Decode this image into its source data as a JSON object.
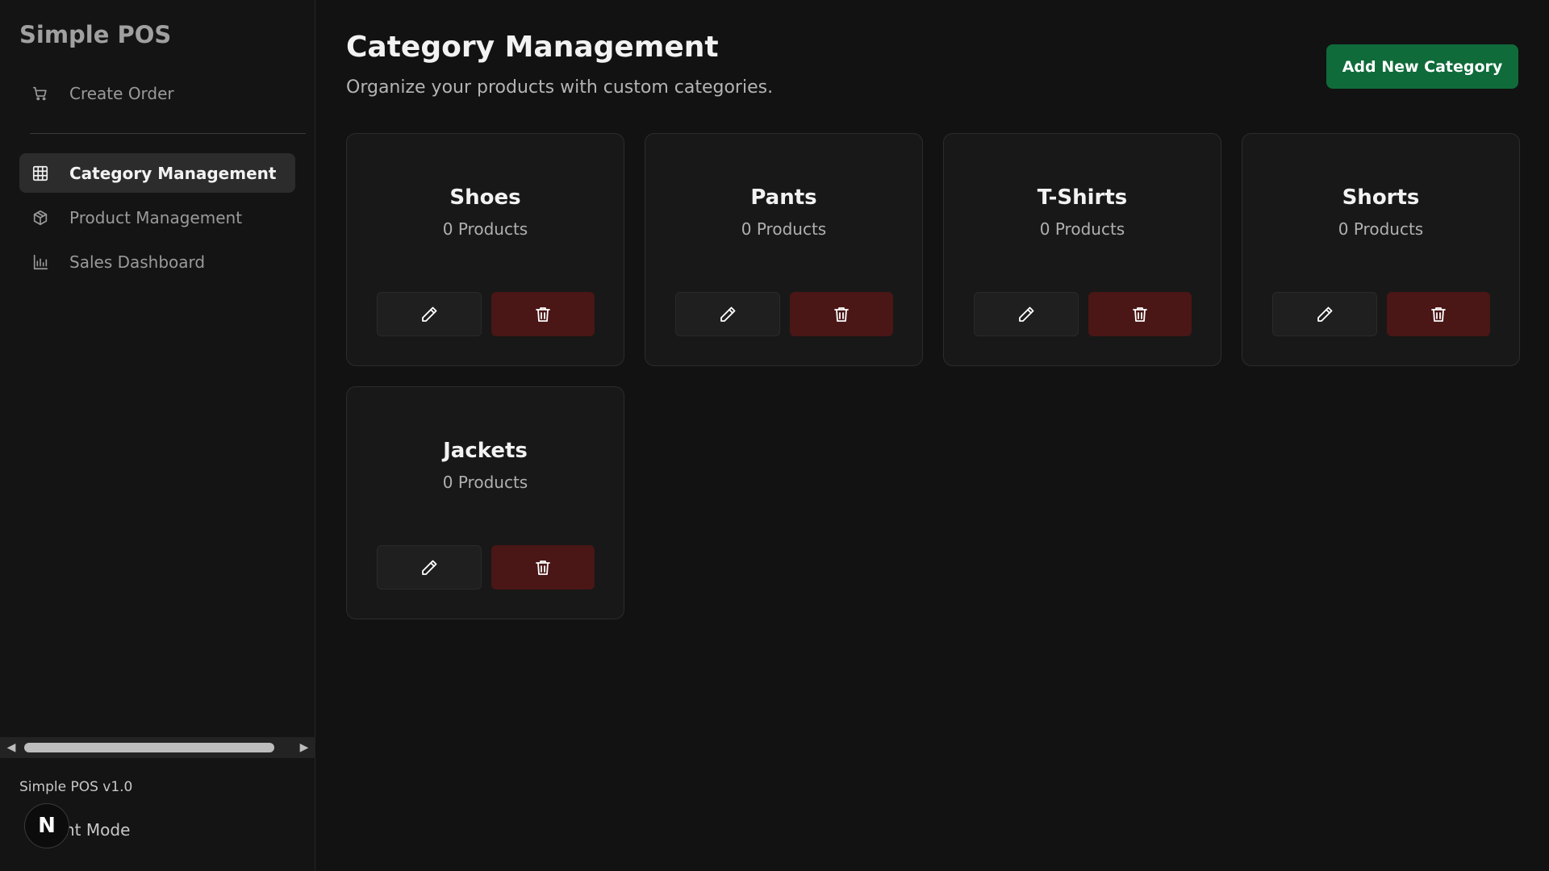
{
  "app": {
    "brand": "Simple POS",
    "version": "Simple POS v1.0",
    "mode_label": "nt Mode",
    "badge_letter": "N"
  },
  "sidebar": {
    "items": [
      {
        "label": "Create Order",
        "icon": "cart-icon",
        "active": false
      },
      {
        "label": "Category Management",
        "icon": "grid-icon",
        "active": true
      },
      {
        "label": "Product Management",
        "icon": "box-icon",
        "active": false
      },
      {
        "label": "Sales Dashboard",
        "icon": "bar-chart-icon",
        "active": false
      }
    ]
  },
  "header": {
    "title": "Category Management",
    "subtitle": "Organize your products with custom categories.",
    "add_button_label": "Add New Category"
  },
  "categories": [
    {
      "name": "Shoes",
      "count": "0 Products"
    },
    {
      "name": "Pants",
      "count": "0 Products"
    },
    {
      "name": "T-Shirts",
      "count": "0 Products"
    },
    {
      "name": "Shorts",
      "count": "0 Products"
    },
    {
      "name": "Jackets",
      "count": "0 Products"
    }
  ],
  "colors": {
    "background": "#121212",
    "accent_green": "#0f6b3a",
    "delete_red": "#4a1616"
  }
}
